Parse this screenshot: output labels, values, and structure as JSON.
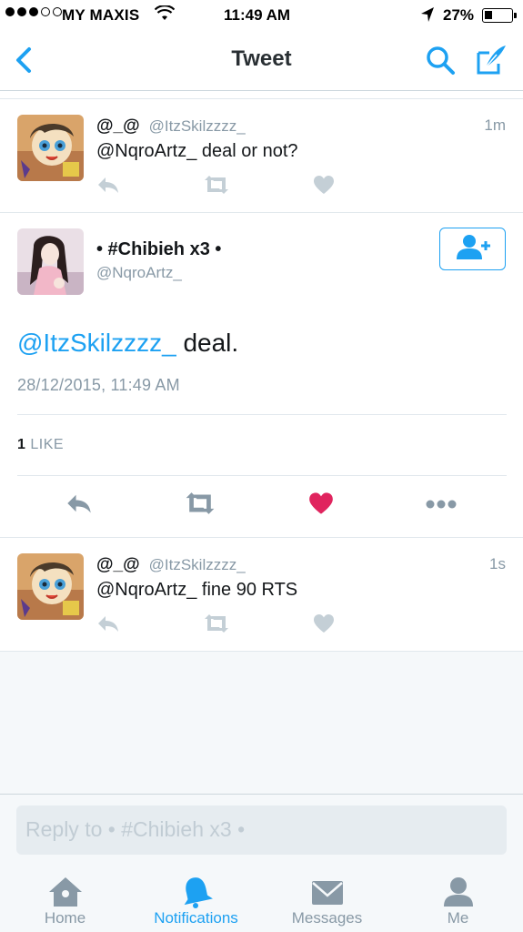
{
  "status_bar": {
    "carrier": "MY MAXIS",
    "time": "11:49 AM",
    "battery": "27%",
    "signal_bars_filled": 3,
    "signal_bars_total": 5
  },
  "nav": {
    "title": "Tweet"
  },
  "tweets": [
    {
      "name": "@_@",
      "handle": "@ItzSkilzzzz_",
      "time": "1m",
      "text": "@NqroArtz_ deal or not?"
    },
    {
      "name": "@_@",
      "handle": "@ItzSkilzzzz_",
      "time": "1s",
      "text": "@NqroArtz_ fine 90 RTS"
    }
  ],
  "main_tweet": {
    "name": "• #Chibieh x3 •",
    "handle": "@NqroArtz_",
    "mention": "@ItzSkilzzzz_",
    "text": " deal.",
    "date": "28/12/2015, 11:49 AM",
    "like_count": "1",
    "like_label": "LIKE"
  },
  "reply": {
    "placeholder": "Reply to • #Chibieh x3  •"
  },
  "tabs": [
    {
      "label": "Home",
      "icon": "home-icon"
    },
    {
      "label": "Notifications",
      "icon": "bell-icon",
      "active": true
    },
    {
      "label": "Messages",
      "icon": "envelope-icon"
    },
    {
      "label": "Me",
      "icon": "person-icon"
    }
  ],
  "colors": {
    "accent": "#1da1f2",
    "like_red": "#e0245e",
    "muted": "#8899a6"
  }
}
